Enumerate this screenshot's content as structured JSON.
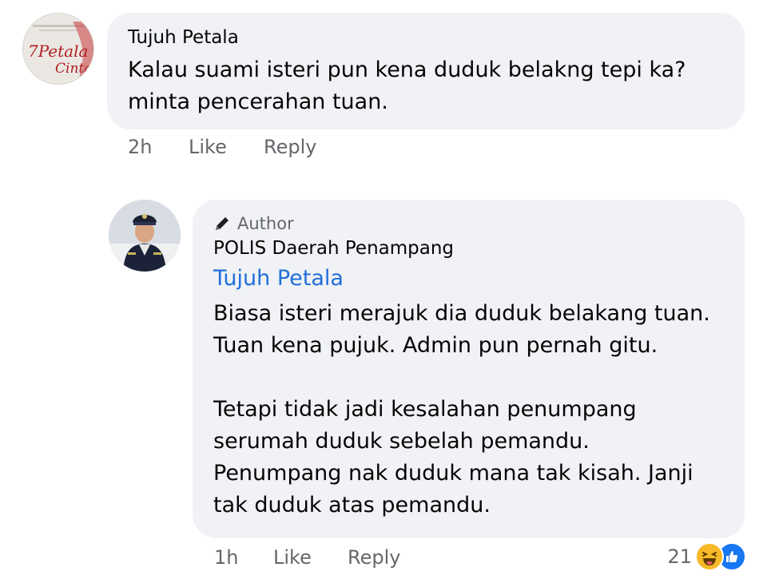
{
  "comment": {
    "avatar_icon": "book-cover-avatar",
    "avatar_text": "7Petala Cinta",
    "author": "Tujuh Petala",
    "text": "Kalau suami isteri pun kena duduk belakng tepi ka?\nminta pencerahan tuan.",
    "time": "2h",
    "like_label": "Like",
    "reply_label": "Reply"
  },
  "reply": {
    "avatar_icon": "police-officer-avatar",
    "badge_icon": "pencil-icon",
    "badge_label": "Author",
    "author": "POLIS Daerah Penampang",
    "mention": "Tujuh Petala",
    "text": "Biasa isteri merajuk dia duduk belakang tuan.\nTuan kena pujuk. Admin pun pernah gitu.\n\nTetapi tidak jadi kesalahan penumpang\nserumah duduk sebelah pemandu.\nPenumpang nak duduk mana tak kisah. Janji\ntak duduk atas pemandu.",
    "time": "1h",
    "like_label": "Like",
    "reply_label": "Reply",
    "reaction_count": "21",
    "reaction_icons": [
      "haha-icon",
      "like-icon"
    ]
  },
  "colors": {
    "bubble": "#f0f2f5",
    "mention": "#216fdb",
    "meta": "#65676b",
    "like_blue": "#1877f2",
    "haha_yellow": "#f7b928"
  }
}
